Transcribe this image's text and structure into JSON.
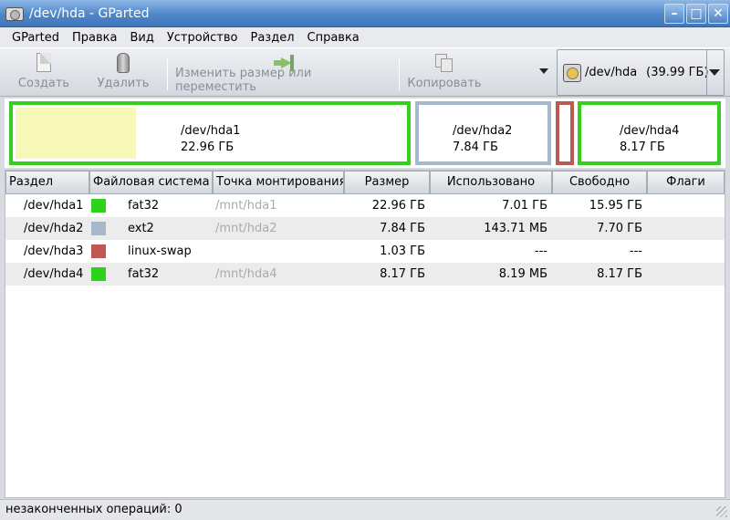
{
  "window": {
    "title": "/dev/hda - GParted",
    "controls": {
      "minimize": "–",
      "maximize": "□",
      "close": "✕"
    }
  },
  "menu": [
    {
      "label": "GParted"
    },
    {
      "label": "Правка"
    },
    {
      "label": "Вид"
    },
    {
      "label": "Устройство"
    },
    {
      "label": "Раздел"
    },
    {
      "label": "Справка"
    }
  ],
  "toolbar": {
    "create_label": "Создать",
    "delete_label": "Удалить",
    "resize_label": "Изменить размер или переместить",
    "copy_label": "Копировать",
    "device": {
      "name": "/dev/hda",
      "size": "(39.99 ГБ)"
    }
  },
  "diskmap": {
    "partitions": [
      {
        "name": "/dev/hda1",
        "size": "22.96 ГБ",
        "fs_color": "#35cf1e",
        "used_fraction": 0.305
      },
      {
        "name": "/dev/hda2",
        "size": "7.84 ГБ",
        "fs_color": "#a6b8cc"
      },
      {
        "name": "/dev/hda3",
        "size": "",
        "fs_color": "#b85b54"
      },
      {
        "name": "/dev/hda4",
        "size": "8.17 ГБ",
        "fs_color": "#35cf1e"
      }
    ]
  },
  "table": {
    "columns": [
      "Раздел",
      "Файловая система",
      "Точка монтирования",
      "Размер",
      "Использовано",
      "Свободно",
      "Флаги"
    ],
    "rows": [
      {
        "partition": "/dev/hda1",
        "filesystem": "fat32",
        "fs_color": "#2fd21b",
        "mount": "/mnt/hda1",
        "size": "22.96 ГБ",
        "used": "7.01 ГБ",
        "free": "15.95 ГБ",
        "flags": ""
      },
      {
        "partition": "/dev/hda2",
        "filesystem": "ext2",
        "fs_color": "#a6b8cc",
        "mount": "/mnt/hda2",
        "size": "7.84 ГБ",
        "used": "143.71 МБ",
        "free": "7.70 ГБ",
        "flags": ""
      },
      {
        "partition": "/dev/hda3",
        "filesystem": "linux-swap",
        "fs_color": "#c05a50",
        "mount": "",
        "size": "1.03 ГБ",
        "used": "---",
        "free": "---",
        "flags": ""
      },
      {
        "partition": "/dev/hda4",
        "filesystem": "fat32",
        "fs_color": "#2fd21b",
        "mount": "/mnt/hda4",
        "size": "8.17 ГБ",
        "used": "8.19 МБ",
        "free": "8.17 ГБ",
        "flags": ""
      }
    ]
  },
  "status": {
    "text": "незаконченных операций: 0"
  }
}
